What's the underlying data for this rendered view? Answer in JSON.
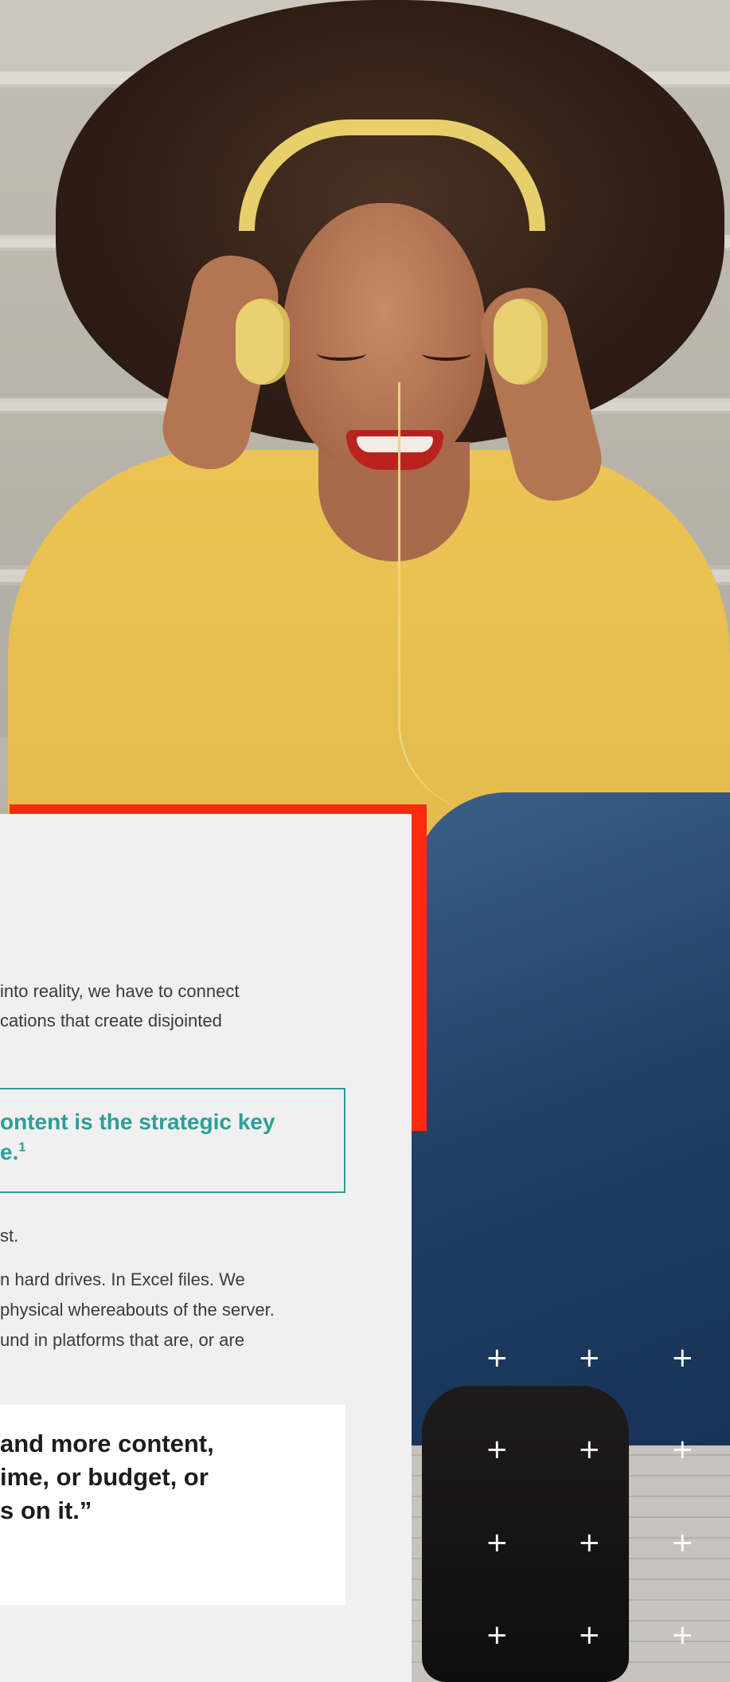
{
  "card": {
    "intro_lines": [
      "into reality, we have to connect",
      "cations that create disjointed"
    ],
    "callout_lines": [
      "ontent is the strategic key",
      "e."
    ],
    "callout_footnote": "1",
    "para1": "st.",
    "para2_lines": [
      "n hard drives. In Excel files. We",
      "physical whereabouts of the server.",
      "und in platforms that are, or are"
    ],
    "quote_lines": [
      "and more content,",
      "ime, or budget, or",
      "s on it.”"
    ]
  },
  "decor": {
    "plus_glyph": "+",
    "accent_red": "#ff2a10",
    "accent_teal": "#2a9f97",
    "photo": "woman-with-headphones-photo"
  }
}
